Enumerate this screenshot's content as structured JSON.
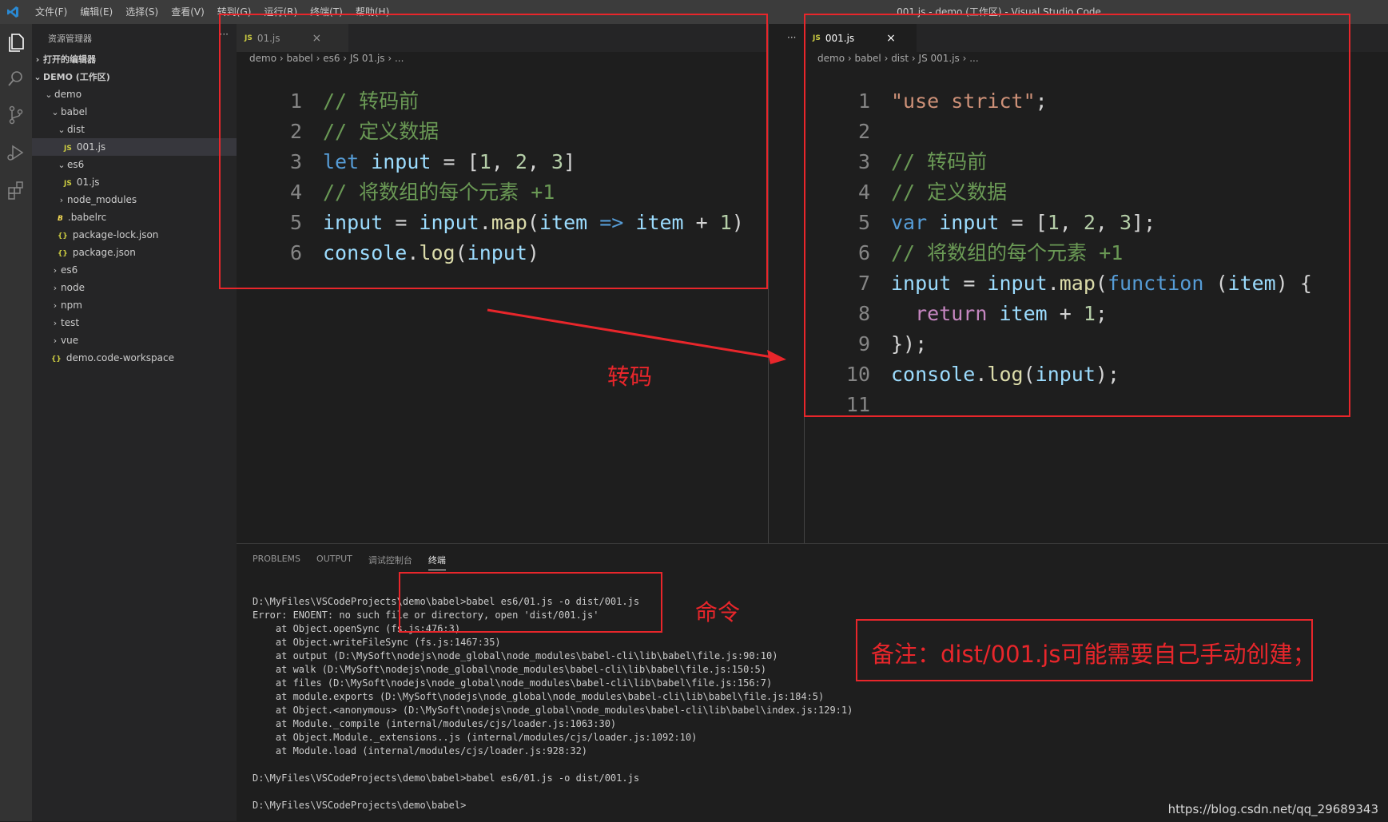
{
  "menu": [
    "文件(F)",
    "编辑(E)",
    "选择(S)",
    "查看(V)",
    "转到(G)",
    "运行(R)",
    "终端(T)",
    "帮助(H)"
  ],
  "window_title": "001.js - demo (工作区) - Visual Studio Code",
  "sidebar": {
    "title": "资源管理器",
    "more": "···",
    "open_editors": "打开的编辑器",
    "workspace": "DEMO (工作区)",
    "items": [
      {
        "label": "demo"
      },
      {
        "label": "babel"
      },
      {
        "label": "dist"
      },
      {
        "label": "001.js",
        "icon": "JS"
      },
      {
        "label": "es6"
      },
      {
        "label": "01.js",
        "icon": "JS"
      },
      {
        "label": "node_modules"
      },
      {
        "label": ".babelrc",
        "icon": "B"
      },
      {
        "label": "package-lock.json",
        "icon": "{}"
      },
      {
        "label": "package.json",
        "icon": "{}"
      },
      {
        "label": "es6"
      },
      {
        "label": "node"
      },
      {
        "label": "npm"
      },
      {
        "label": "test"
      },
      {
        "label": "vue"
      },
      {
        "label": "demo.code-workspace",
        "icon": "{}"
      }
    ]
  },
  "left_editor": {
    "tab_icon": "JS",
    "tab": "01.js",
    "close": "×",
    "breadcrumb": "demo › babel › es6 › JS 01.js › ...",
    "line_numbers": [
      "1",
      "2",
      "3",
      "4",
      "5",
      "6"
    ],
    "lines": [
      [
        {
          "t": "// 转码前",
          "c": "c-com"
        }
      ],
      [
        {
          "t": "// 定义数据",
          "c": "c-com"
        }
      ],
      [
        {
          "t": "let",
          "c": "c-kw"
        },
        {
          "t": " input",
          "c": "c-var"
        },
        {
          "t": " = [",
          "c": "c-op"
        },
        {
          "t": "1",
          "c": "c-num"
        },
        {
          "t": ", ",
          "c": "c-op"
        },
        {
          "t": "2",
          "c": "c-num"
        },
        {
          "t": ", ",
          "c": "c-op"
        },
        {
          "t": "3",
          "c": "c-num"
        },
        {
          "t": "]",
          "c": "c-op"
        }
      ],
      [
        {
          "t": "// 将数组的每个元素 +1",
          "c": "c-com"
        }
      ],
      [
        {
          "t": "input",
          "c": "c-var"
        },
        {
          "t": " = ",
          "c": "c-op"
        },
        {
          "t": "input",
          "c": "c-var"
        },
        {
          "t": ".",
          "c": "c-op"
        },
        {
          "t": "map",
          "c": "c-fn"
        },
        {
          "t": "(",
          "c": "c-op"
        },
        {
          "t": "item",
          "c": "c-var"
        },
        {
          "t": " => ",
          "c": "c-kw"
        },
        {
          "t": "item",
          "c": "c-var"
        },
        {
          "t": " + ",
          "c": "c-op"
        },
        {
          "t": "1",
          "c": "c-num"
        },
        {
          "t": ")",
          "c": "c-op"
        }
      ],
      [
        {
          "t": "console",
          "c": "c-var"
        },
        {
          "t": ".",
          "c": "c-op"
        },
        {
          "t": "log",
          "c": "c-fn"
        },
        {
          "t": "(",
          "c": "c-op"
        },
        {
          "t": "input",
          "c": "c-var"
        },
        {
          "t": ")",
          "c": "c-op"
        }
      ]
    ]
  },
  "right_editor": {
    "tab_icon": "JS",
    "tab": "001.js",
    "close": "×",
    "breadcrumb": "demo › babel › dist › JS 001.js › ...",
    "more": "···",
    "line_numbers": [
      "1",
      "2",
      "3",
      "4",
      "5",
      "6",
      "7",
      "8",
      "9",
      "10",
      "11"
    ],
    "lines": [
      [
        {
          "t": "\"use strict\"",
          "c": "c-str"
        },
        {
          "t": ";",
          "c": "c-op"
        }
      ],
      [],
      [
        {
          "t": "// 转码前",
          "c": "c-com"
        }
      ],
      [
        {
          "t": "// 定义数据",
          "c": "c-com"
        }
      ],
      [
        {
          "t": "var",
          "c": "c-kw"
        },
        {
          "t": " input",
          "c": "c-var"
        },
        {
          "t": " = [",
          "c": "c-op"
        },
        {
          "t": "1",
          "c": "c-num"
        },
        {
          "t": ", ",
          "c": "c-op"
        },
        {
          "t": "2",
          "c": "c-num"
        },
        {
          "t": ", ",
          "c": "c-op"
        },
        {
          "t": "3",
          "c": "c-num"
        },
        {
          "t": "];",
          "c": "c-op"
        }
      ],
      [
        {
          "t": "// 将数组的每个元素 +1",
          "c": "c-com"
        }
      ],
      [
        {
          "t": "input",
          "c": "c-var"
        },
        {
          "t": " = ",
          "c": "c-op"
        },
        {
          "t": "input",
          "c": "c-var"
        },
        {
          "t": ".",
          "c": "c-op"
        },
        {
          "t": "map",
          "c": "c-fn"
        },
        {
          "t": "(",
          "c": "c-op"
        },
        {
          "t": "function",
          "c": "c-kw"
        },
        {
          "t": " (",
          "c": "c-op"
        },
        {
          "t": "item",
          "c": "c-var"
        },
        {
          "t": ") {",
          "c": "c-op"
        }
      ],
      [
        {
          "t": "  return",
          "c": "c-ret"
        },
        {
          "t": " item",
          "c": "c-var"
        },
        {
          "t": " + ",
          "c": "c-op"
        },
        {
          "t": "1",
          "c": "c-num"
        },
        {
          "t": ";",
          "c": "c-op"
        }
      ],
      [
        {
          "t": "});",
          "c": "c-op"
        }
      ],
      [
        {
          "t": "console",
          "c": "c-var"
        },
        {
          "t": ".",
          "c": "c-op"
        },
        {
          "t": "log",
          "c": "c-fn"
        },
        {
          "t": "(",
          "c": "c-op"
        },
        {
          "t": "input",
          "c": "c-var"
        },
        {
          "t": ");",
          "c": "c-op"
        }
      ],
      []
    ]
  },
  "panel": {
    "tabs": [
      "PROBLEMS",
      "OUTPUT",
      "调试控制台",
      "终端"
    ],
    "terminal_lines": [
      "D:\\MyFiles\\VSCodeProjects\\demo\\babel>babel es6/01.js -o dist/001.js",
      "Error: ENOENT: no such file or directory, open 'dist/001.js'",
      "    at Object.openSync (fs.js:476:3)",
      "    at Object.writeFileSync (fs.js:1467:35)",
      "    at output (D:\\MySoft\\nodejs\\node_global\\node_modules\\babel-cli\\lib\\babel\\file.js:90:10)",
      "    at walk (D:\\MySoft\\nodejs\\node_global\\node_modules\\babel-cli\\lib\\babel\\file.js:150:5)",
      "    at files (D:\\MySoft\\nodejs\\node_global\\node_modules\\babel-cli\\lib\\babel\\file.js:156:7)",
      "    at module.exports (D:\\MySoft\\nodejs\\node_global\\node_modules\\babel-cli\\lib\\babel\\file.js:184:5)",
      "    at Object.<anonymous> (D:\\MySoft\\nodejs\\node_global\\node_modules\\babel-cli\\lib\\babel\\index.js:129:1)",
      "    at Module._compile (internal/modules/cjs/loader.js:1063:30)",
      "    at Object.Module._extensions..js (internal/modules/cjs/loader.js:1092:10)",
      "    at Module.load (internal/modules/cjs/loader.js:928:32)",
      "",
      "D:\\MyFiles\\VSCodeProjects\\demo\\babel>babel es6/01.js -o dist/001.js",
      "",
      "D:\\MyFiles\\VSCodeProjects\\demo\\babel>"
    ]
  },
  "annotations": {
    "transcode": "转码",
    "command": "命令",
    "note": "备注：dist/001.js可能需要自己手动创建；",
    "red": "#e8262b"
  },
  "watermark": "https://blog.csdn.net/qq_29689343"
}
